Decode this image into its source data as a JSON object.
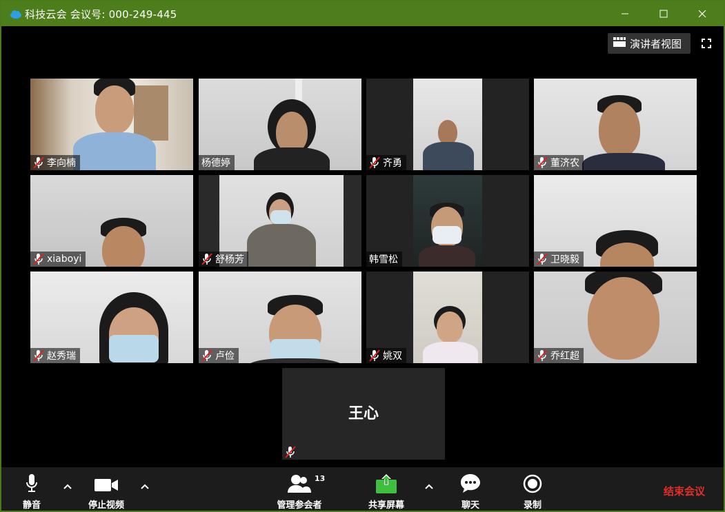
{
  "window": {
    "title": "科技云会 会议号: 000-249-445",
    "controls": [
      "minimize",
      "maximize",
      "close"
    ]
  },
  "top_controls": {
    "speaker_view_label": "演讲者视图",
    "speaker_view_icon": "grid-icon",
    "fullscreen_icon": "fullscreen-icon"
  },
  "participants": [
    {
      "name": "李向楠",
      "muted": true,
      "active": false
    },
    {
      "name": "杨德婷",
      "muted": false,
      "active": false
    },
    {
      "name": "齐勇",
      "muted": true,
      "active": false
    },
    {
      "name": "董济农",
      "muted": true,
      "active": false
    },
    {
      "name": "xiaboyi",
      "muted": true,
      "active": false
    },
    {
      "name": "舒杨芳",
      "muted": true,
      "active": false
    },
    {
      "name": "韩雪松",
      "muted": false,
      "active": true
    },
    {
      "name": "卫晓毅",
      "muted": true,
      "active": false
    },
    {
      "name": "赵秀瑞",
      "muted": true,
      "active": false
    },
    {
      "name": "卢俭",
      "muted": true,
      "active": false
    },
    {
      "name": "姚双",
      "muted": true,
      "active": false
    },
    {
      "name": "乔红超",
      "muted": true,
      "active": false
    }
  ],
  "novideo_participant": {
    "name": "王心",
    "muted": true
  },
  "toolbar": {
    "mute_label": "静音",
    "stop_video_label": "停止视频",
    "manage_participants_label": "管理参会者",
    "participant_count": "13",
    "share_screen_label": "共享屏幕",
    "chat_label": "聊天",
    "record_label": "录制",
    "end_meeting_label": "结束会议",
    "share_color": "#3fbf3f",
    "end_color": "#e0302a"
  }
}
